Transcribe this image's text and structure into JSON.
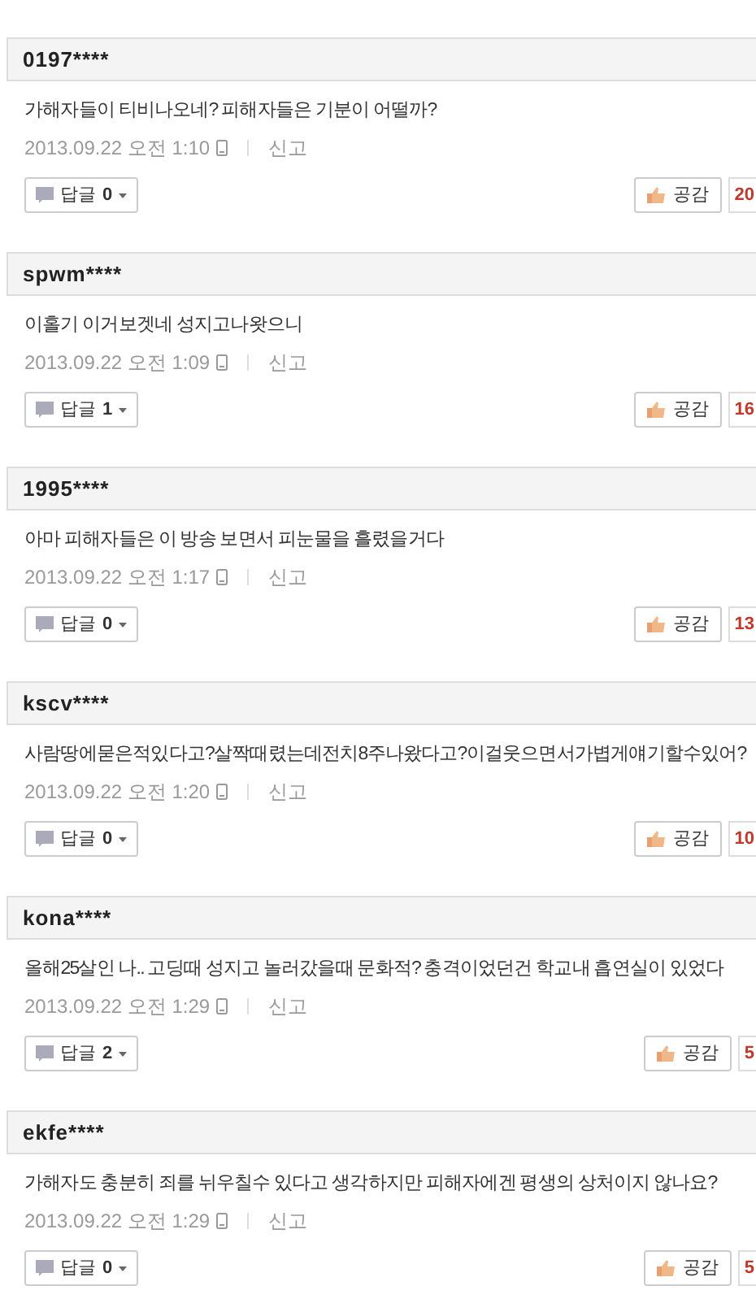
{
  "comments": [
    {
      "user": "0197****",
      "text": "가해자들이 티비나오네? 피해자들은 기분이 어떨까?",
      "time": "2013.09.22 오전 1:10",
      "report": "신고",
      "reply_label": "답글",
      "reply_count": "0",
      "like_label": "공감",
      "like_count": "20"
    },
    {
      "user": "spwm****",
      "text": "이홀기 이거보겟네 성지고나왓으니",
      "time": "2013.09.22 오전 1:09",
      "report": "신고",
      "reply_label": "답글",
      "reply_count": "1",
      "like_label": "공감",
      "like_count": "16"
    },
    {
      "user": "1995****",
      "text": "아마 피해자들은 이 방송 보면서 피눈물을 흘렸을거다",
      "time": "2013.09.22 오전 1:17",
      "report": "신고",
      "reply_label": "답글",
      "reply_count": "0",
      "like_label": "공감",
      "like_count": "13"
    },
    {
      "user": "kscv****",
      "text": "사람땅에묻은적있다고?살짝때렸는데전치8주나왔다고?이걸웃으면서가볍게얘기할수있어?",
      "time": "2013.09.22 오전 1:20",
      "report": "신고",
      "reply_label": "답글",
      "reply_count": "0",
      "like_label": "공감",
      "like_count": "10"
    },
    {
      "user": "kona****",
      "text": "올해25살인 나.. 고딩때 성지고 놀러갔을때 문화적? 충격이었던건 학교내 흡연실이 있었다",
      "time": "2013.09.22 오전 1:29",
      "report": "신고",
      "reply_label": "답글",
      "reply_count": "2",
      "like_label": "공감",
      "like_count": "5"
    },
    {
      "user": "ekfe****",
      "text": "가해자도 충분히 죄를 뉘우칠수 있다고 생각하지만 피해자에겐 평생의 상처이지 않나요?",
      "time": "2013.09.22 오전 1:29",
      "report": "신고",
      "reply_label": "답글",
      "reply_count": "0",
      "like_label": "공감",
      "like_count": "5"
    }
  ]
}
